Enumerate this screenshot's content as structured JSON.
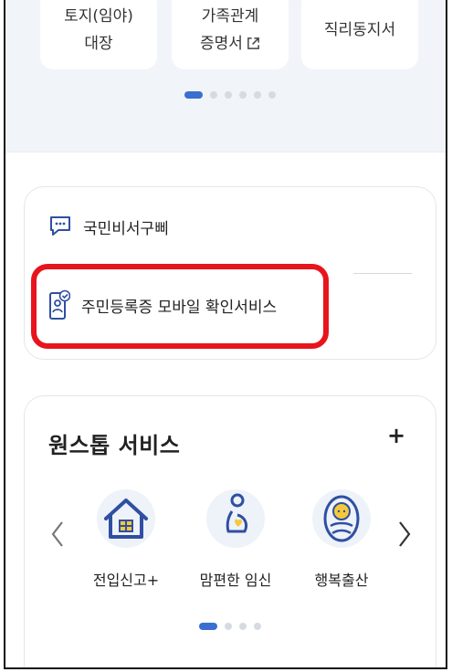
{
  "tiles": [
    {
      "line1": "토지(임야)",
      "line2": "대장"
    },
    {
      "line1": "가족관계",
      "line2": "증명서",
      "icon": "external-link-icon"
    },
    {
      "line1": "직리동지서",
      "line2": ""
    }
  ],
  "top_pager": {
    "total": 6,
    "active": 0
  },
  "quick_links": [
    {
      "label": "국민비서구삐",
      "icon": "chat-bubble-icon"
    },
    {
      "label": "주민등록증 모바일 확인서비스",
      "icon": "mobile-id-check-icon"
    }
  ],
  "onestop": {
    "title": "원스톱 서비스",
    "add_label": "+",
    "services": [
      {
        "label": "전입신고+",
        "icon": "house-icon"
      },
      {
        "label": "맘편한 임신",
        "icon": "pregnant-woman-icon"
      },
      {
        "label": "행복출산",
        "icon": "baby-icon"
      }
    ],
    "pager": {
      "total": 4,
      "active": 0
    }
  },
  "colors": {
    "accent": "#3a6fd0",
    "highlight": "#e8141c",
    "icon_blue": "#2f4fa2",
    "icon_yellow": "#f5c93a"
  }
}
